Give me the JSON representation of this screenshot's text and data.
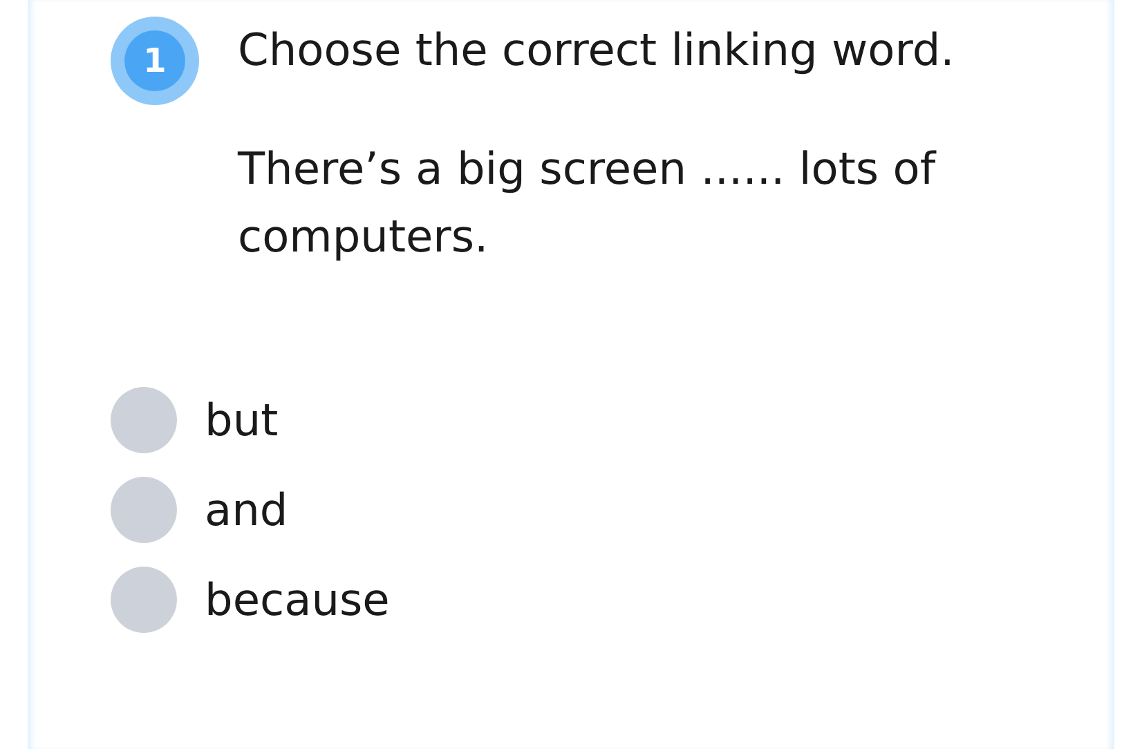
{
  "question": {
    "number": "1",
    "prompt": "Choose the correct linking word.",
    "sentence": "There’s a big screen ...... lots of computers."
  },
  "options": [
    {
      "label": "but",
      "selected": false
    },
    {
      "label": "and",
      "selected": false
    },
    {
      "label": "because",
      "selected": false
    }
  ]
}
